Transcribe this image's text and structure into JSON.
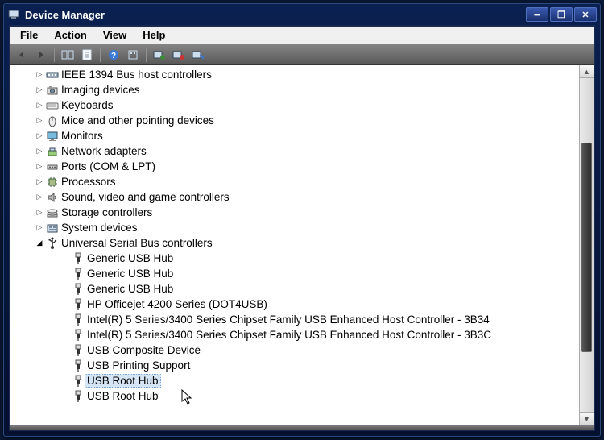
{
  "window": {
    "title": "Device Manager"
  },
  "menubar": [
    "File",
    "Action",
    "View",
    "Help"
  ],
  "tree": {
    "categories": [
      {
        "label": "IEEE 1394 Bus host controllers",
        "icon": "bus"
      },
      {
        "label": "Imaging devices",
        "icon": "camera"
      },
      {
        "label": "Keyboards",
        "icon": "keyboard"
      },
      {
        "label": "Mice and other pointing devices",
        "icon": "mouse"
      },
      {
        "label": "Monitors",
        "icon": "monitor"
      },
      {
        "label": "Network adapters",
        "icon": "network"
      },
      {
        "label": "Ports (COM & LPT)",
        "icon": "port"
      },
      {
        "label": "Processors",
        "icon": "cpu"
      },
      {
        "label": "Sound, video and game controllers",
        "icon": "sound"
      },
      {
        "label": "Storage controllers",
        "icon": "storage"
      },
      {
        "label": "System devices",
        "icon": "system"
      }
    ],
    "usb_category": {
      "label": "Universal Serial Bus controllers",
      "icon": "usb",
      "children": [
        {
          "label": "Generic USB Hub",
          "icon": "usb-plug"
        },
        {
          "label": "Generic USB Hub",
          "icon": "usb-plug"
        },
        {
          "label": "Generic USB Hub",
          "icon": "usb-plug"
        },
        {
          "label": "HP Officejet 4200 Series (DOT4USB)",
          "icon": "usb-plug"
        },
        {
          "label": "Intel(R) 5 Series/3400 Series Chipset Family USB Enhanced Host Controller - 3B34",
          "icon": "usb-plug"
        },
        {
          "label": "Intel(R) 5 Series/3400 Series Chipset Family USB Enhanced Host Controller - 3B3C",
          "icon": "usb-plug"
        },
        {
          "label": "USB Composite Device",
          "icon": "usb-plug"
        },
        {
          "label": "USB Printing Support",
          "icon": "usb-plug"
        },
        {
          "label": "USB Root Hub",
          "icon": "usb-plug",
          "selected": true
        },
        {
          "label": "USB Root Hub",
          "icon": "usb-plug"
        }
      ]
    }
  }
}
